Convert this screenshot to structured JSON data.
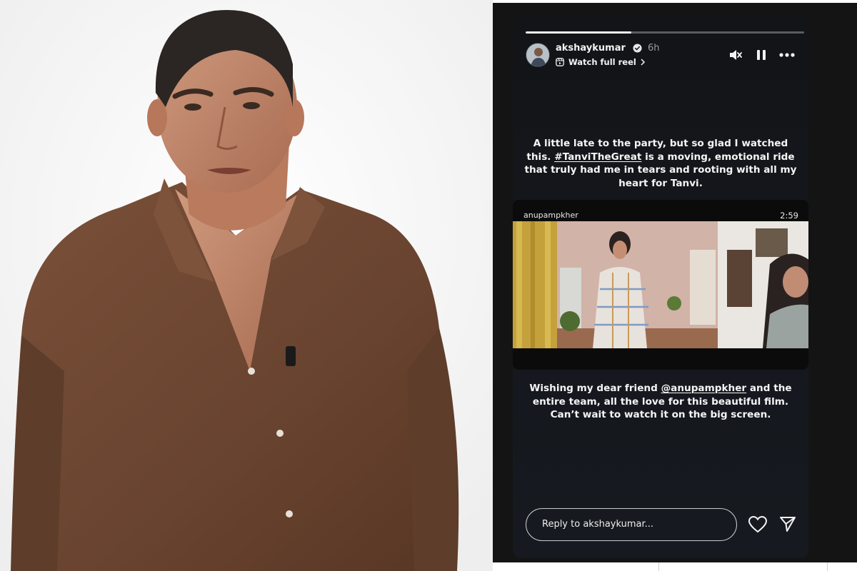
{
  "story": {
    "progress_fraction": 0.38,
    "username": "akshaykumar",
    "verified_icon": "verified-badge-icon",
    "time_ago": "6h",
    "watch_full_reel": "Watch full reel",
    "controls": [
      "mute-icon",
      "pause-icon",
      "more-options-icon"
    ],
    "caption_top": {
      "line_1": "A little late to the party, but so glad I watched",
      "line_2_pre": "this. ",
      "line_2_tag": "#TanviTheGreat",
      "line_2_post": " is a moving, emotional ride",
      "line_3": "that truly had me in tears and rooting with all my",
      "line_4": "heart for Tanvi."
    },
    "shared_reel": {
      "username": "anupampkher",
      "duration": "2:59"
    },
    "caption_bottom": {
      "line_1_pre": "Wishing my dear friend ",
      "line_1_tag": "@anupampkher",
      "line_1_post": " and the",
      "line_2": "entire team, all the love for this beautiful film.",
      "line_3": "Can’t wait to watch it on the big screen."
    },
    "reply_placeholder": "Reply to akshaykumar...",
    "footer_icons": [
      "heart-icon",
      "send-icon"
    ]
  },
  "colors": {
    "story_background": "#14171c",
    "text_primary": "#f5f5f5",
    "text_secondary": "#9a9da3",
    "verified_blue": "#3897f0",
    "shirt_brown": "#6f4a35"
  }
}
